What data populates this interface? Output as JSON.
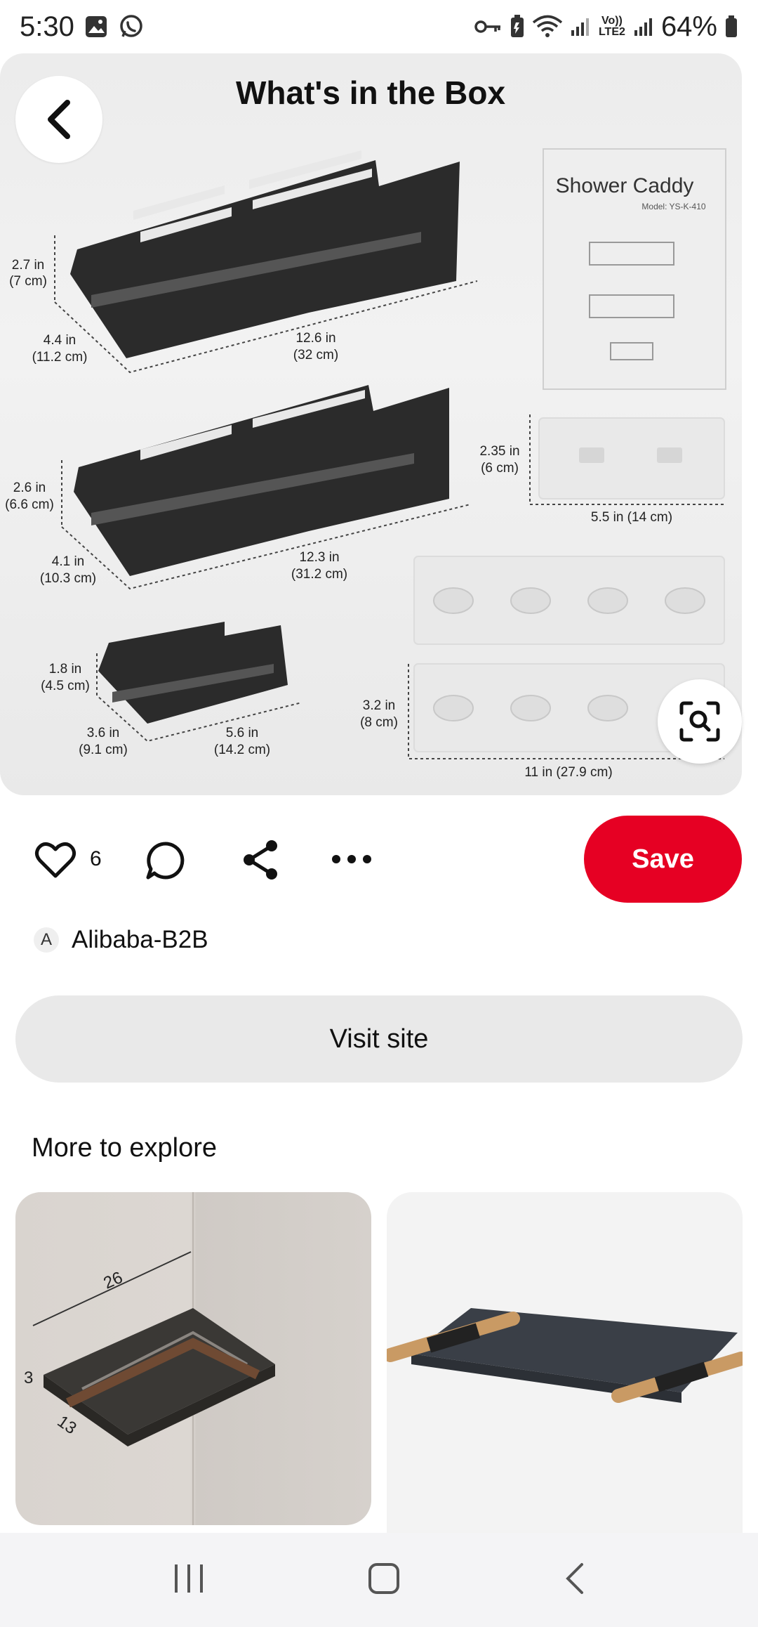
{
  "status_bar": {
    "time": "5:30",
    "battery": "64%",
    "network_label": "Vo)) LTE2"
  },
  "pin": {
    "image_title": "What's in the Box",
    "booklet_title": "Shower Caddy",
    "booklet_model": "Model: YS-K-410",
    "dims": {
      "big_h_in": "2.7 in",
      "big_h_cm": "(7 cm)",
      "big_d_in": "4.4 in",
      "big_d_cm": "(11.2 cm)",
      "big_w_in": "12.6 in",
      "big_w_cm": "(32 cm)",
      "mid_h_in": "2.6 in",
      "mid_h_cm": "(6.6 cm)",
      "mid_d_in": "4.1 in",
      "mid_d_cm": "(10.3 cm)",
      "mid_w_in": "12.3 in",
      "mid_w_cm": "(31.2 cm)",
      "sm_h_in": "1.8 in",
      "sm_h_cm": "(4.5 cm)",
      "sm_d_in": "3.6 in",
      "sm_d_cm": "(9.1 cm)",
      "sm_w_in": "5.6 in",
      "sm_w_cm": "(14.2 cm)",
      "strip_h_in": "2.35 in",
      "strip_h_cm": "(6 cm)",
      "strip_w": "5.5 in (14 cm)",
      "hook_h_in": "3.2 in",
      "hook_h_cm": "(8 cm)",
      "hook_w": "11 in (27.9 cm)"
    }
  },
  "actions": {
    "like_count": "6",
    "save_label": "Save"
  },
  "source": {
    "avatar_letter": "A",
    "name": "Alibaba-B2B"
  },
  "visit_label": "Visit site",
  "explore": {
    "title": "More to explore",
    "card1_dims": {
      "top": "26",
      "left": "3",
      "bottom": "13"
    }
  },
  "colors": {
    "accent": "#e60023",
    "button_gray": "#e9e9e9"
  },
  "icons": [
    "back-arrow-icon",
    "visual-search-icon",
    "heart-icon",
    "comment-icon",
    "share-icon",
    "more-icon",
    "recents-icon",
    "home-icon",
    "back-icon"
  ]
}
